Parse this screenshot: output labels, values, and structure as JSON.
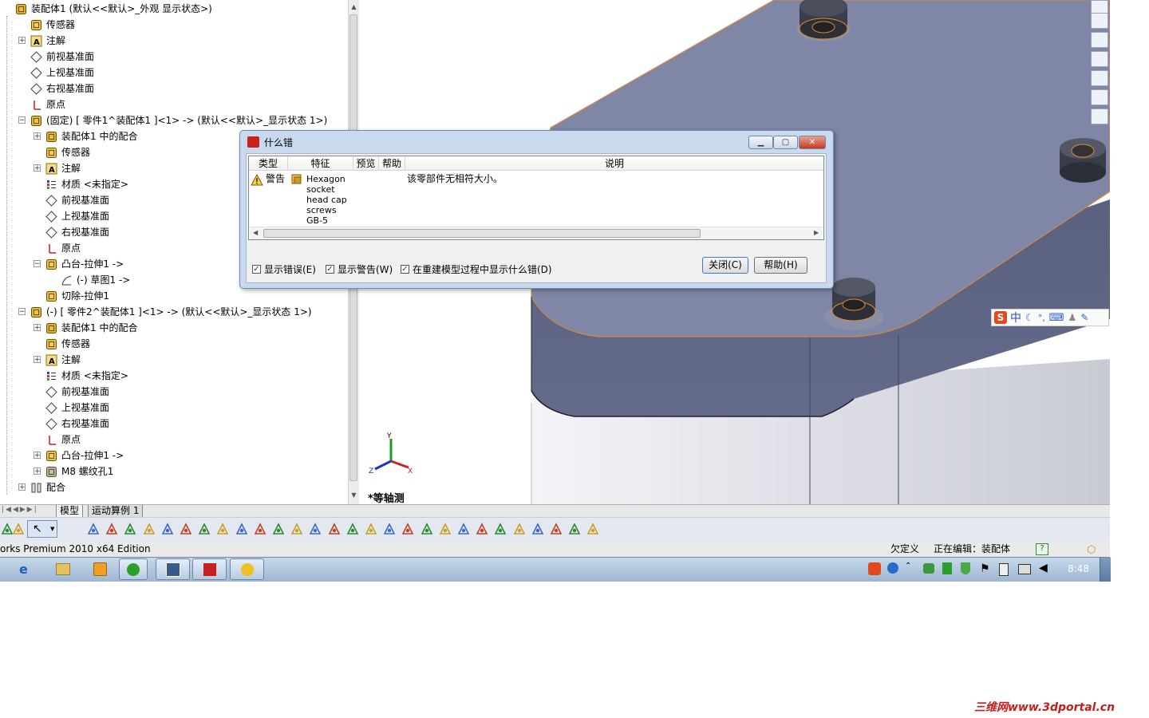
{
  "tree": {
    "items": [
      {
        "label": "装配体1  (默认<<默认>_外观 显示状态>)",
        "icon": "assembly-icon"
      },
      {
        "label": "传感器",
        "icon": "sensor-icon"
      },
      {
        "label": "注解",
        "icon": "annotation-icon"
      },
      {
        "label": "前视基准面",
        "icon": "plane-icon"
      },
      {
        "label": "上视基准面",
        "icon": "plane-icon"
      },
      {
        "label": "右视基准面",
        "icon": "plane-icon"
      },
      {
        "label": "原点",
        "icon": "origin-icon"
      },
      {
        "label": "(固定) [ 零件1^装配体1 ]<1> -> (默认<<默认>_显示状态 1>)",
        "icon": "part-icon"
      },
      {
        "label": "装配体1 中的配合",
        "icon": "mate-group-icon"
      },
      {
        "label": "传感器",
        "icon": "sensor-icon"
      },
      {
        "label": "注解",
        "icon": "annotation-icon"
      },
      {
        "label": "材质 <未指定>",
        "icon": "material-icon"
      },
      {
        "label": "前视基准面",
        "icon": "plane-icon"
      },
      {
        "label": "上视基准面",
        "icon": "plane-icon"
      },
      {
        "label": "右视基准面",
        "icon": "plane-icon"
      },
      {
        "label": "原点",
        "icon": "origin-icon"
      },
      {
        "label": "凸台-拉伸1 ->",
        "icon": "extrude-icon"
      },
      {
        "label": "(-) 草图1 ->",
        "icon": "sketch-icon"
      },
      {
        "label": "切除-拉伸1",
        "icon": "cut-icon"
      },
      {
        "label": "(-) [ 零件2^装配体1 ]<1> -> (默认<<默认>_显示状态 1>)",
        "icon": "part-icon"
      },
      {
        "label": "装配体1 中的配合",
        "icon": "mate-group-icon"
      },
      {
        "label": "传感器",
        "icon": "sensor-icon"
      },
      {
        "label": "注解",
        "icon": "annotation-icon"
      },
      {
        "label": "材质 <未指定>",
        "icon": "material-icon"
      },
      {
        "label": "前视基准面",
        "icon": "plane-icon"
      },
      {
        "label": "上视基准面",
        "icon": "plane-icon"
      },
      {
        "label": "右视基准面",
        "icon": "plane-icon"
      },
      {
        "label": "原点",
        "icon": "origin-icon"
      },
      {
        "label": "凸台-拉伸1 ->",
        "icon": "extrude-icon"
      },
      {
        "label": "M8 螺纹孔1",
        "icon": "hole-icon"
      },
      {
        "label": "配合",
        "icon": "mates-icon"
      }
    ]
  },
  "viewport": {
    "view_label": "*等轴测",
    "axis_y": "Y",
    "axis_x": "X",
    "axis_z": "Z"
  },
  "tabs": [
    "模型",
    "运动算例 1"
  ],
  "status": {
    "left": "orks Premium 2010 x64 Edition",
    "state": "欠定义",
    "editing": "正在编辑：装配体",
    "help": "?"
  },
  "taskbar": {
    "time": "8:48"
  },
  "ime": {
    "mode": "中"
  },
  "dialog": {
    "title": "什么错",
    "columns": [
      "类型",
      "特征",
      "预览",
      "帮助",
      "说明"
    ],
    "row": {
      "type": "警告",
      "feature_lines": [
        "Hexagon",
        "socket",
        "head cap",
        "screws",
        "GB-5"
      ],
      "description": "该零部件无相符大小。"
    },
    "checkboxes": [
      {
        "label": "显示错误(E)",
        "checked": true
      },
      {
        "label": "显示警告(W)",
        "checked": true
      },
      {
        "label": "在重建模型过程中显示什么错(D)",
        "checked": true
      }
    ],
    "close_label": "关闭(C)",
    "help_label": "帮助(H)"
  },
  "watermark": "三维网www.3dportal.cn"
}
